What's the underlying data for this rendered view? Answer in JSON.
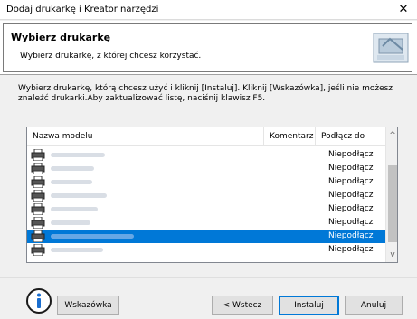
{
  "window": {
    "title": "Dodaj drukarkę i Kreator narzędzi",
    "close_glyph": "✕"
  },
  "header": {
    "heading": "Wybierz drukarkę",
    "subheading": "Wybierz drukarkę, z której chcesz korzystać.",
    "icon": "printer-wizard-icon"
  },
  "instruction": "Wybierz drukarkę, którą chcesz użyć i kliknij [Instaluj]. Kliknij [Wskazówka], jeśli nie możesz znaleźć drukarki.Aby zaktualizować listę, naciśnij klawisz F5.",
  "list": {
    "columns": {
      "model": "Nazwa modelu",
      "comment": "Komentarz",
      "connect": "Podłącz do"
    },
    "rows": [
      {
        "port": "Niepodłącz",
        "selected": false
      },
      {
        "port": "Niepodłącz",
        "selected": false
      },
      {
        "port": "Niepodłącz",
        "selected": false
      },
      {
        "port": "Niepodłącz",
        "selected": false
      },
      {
        "port": "Niepodłącz",
        "selected": false
      },
      {
        "port": "Niepodłącz",
        "selected": false
      },
      {
        "port": "Niepodłącz",
        "selected": true
      },
      {
        "port": "Niepodłącz",
        "selected": false
      }
    ],
    "scroll_up_glyph": "^",
    "scroll_down_glyph": "v"
  },
  "buttons": {
    "hint": "Wskazówka",
    "back": "< Wstecz",
    "install": "Instaluj",
    "cancel": "Anuluj"
  },
  "colors": {
    "selection": "#0078d7",
    "default_button_border": "#0078d7"
  }
}
